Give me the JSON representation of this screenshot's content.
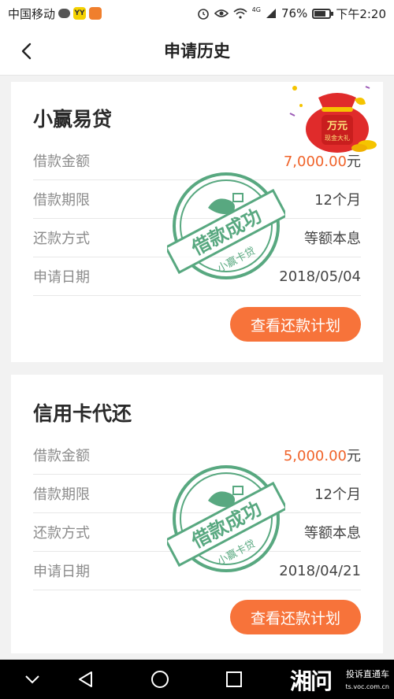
{
  "status_bar": {
    "carrier": "中国移动",
    "yy_badge": "YY",
    "network_badge": "4G",
    "battery": "76%",
    "battery_level": 0.76,
    "time": "下午2:20"
  },
  "nav": {
    "title": "申请历史",
    "back_icon": "chevron-left-icon"
  },
  "promo": {
    "big_text": "万元",
    "small_text": "现金大礼",
    "icon": "red-gift-bag-icon"
  },
  "colors": {
    "accent": "#f7733a",
    "amount": "#f0632a",
    "stamp": "#3c9a6a"
  },
  "applications": [
    {
      "title": "小赢易贷",
      "rows": [
        {
          "label": "借款金额",
          "value": "7,000.00",
          "unit": "元"
        },
        {
          "label": "借款期限",
          "value": "12个月"
        },
        {
          "label": "还款方式",
          "value": "等额本息"
        },
        {
          "label": "申请日期",
          "value": "2018/05/04"
        }
      ],
      "stamp_main": "借款成功",
      "stamp_sub": "小赢卡贷",
      "button_label": "查看还款计划"
    },
    {
      "title": "信用卡代还",
      "rows": [
        {
          "label": "借款金额",
          "value": "5,000.00",
          "unit": "元"
        },
        {
          "label": "借款期限",
          "value": "12个月"
        },
        {
          "label": "还款方式",
          "value": "等额本息"
        },
        {
          "label": "申请日期",
          "value": "2018/04/21"
        }
      ],
      "stamp_main": "借款成功",
      "stamp_sub": "小赢卡贷",
      "button_label": "查看还款计划"
    }
  ],
  "watermark": {
    "big": "湘问",
    "small": "投诉直通车",
    "url": "ts.voc.com.cn"
  }
}
